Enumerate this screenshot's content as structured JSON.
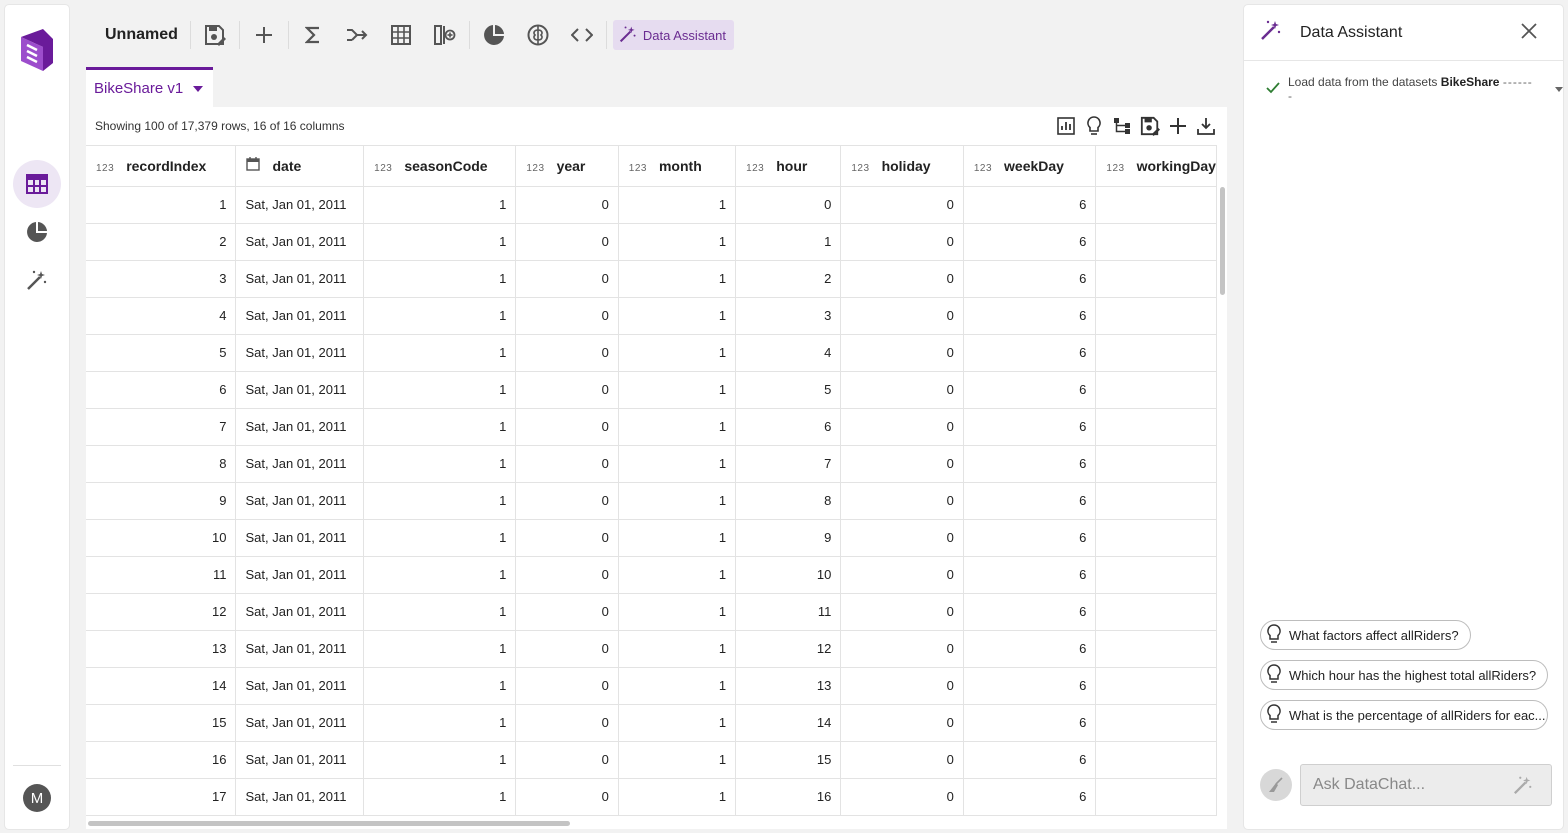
{
  "toolbar": {
    "title": "Unnamed",
    "assistant_label": "Data Assistant"
  },
  "tab": {
    "label": "BikeShare v1"
  },
  "grid": {
    "info": "Showing 100 of 17,379 rows, 16 of 16 columns",
    "type_num": "123",
    "columns": [
      {
        "name": "recordIndex",
        "type": "123"
      },
      {
        "name": "date",
        "type": "calendar"
      },
      {
        "name": "seasonCode",
        "type": "123"
      },
      {
        "name": "year",
        "type": "123"
      },
      {
        "name": "month",
        "type": "123"
      },
      {
        "name": "hour",
        "type": "123"
      },
      {
        "name": "holiday",
        "type": "123"
      },
      {
        "name": "weekDay",
        "type": "123"
      },
      {
        "name": "workingDay",
        "type": "123"
      }
    ],
    "rows": [
      [
        "1",
        "Sat, Jan 01, 2011",
        "1",
        "0",
        "1",
        "0",
        "0",
        "6",
        ""
      ],
      [
        "2",
        "Sat, Jan 01, 2011",
        "1",
        "0",
        "1",
        "1",
        "0",
        "6",
        ""
      ],
      [
        "3",
        "Sat, Jan 01, 2011",
        "1",
        "0",
        "1",
        "2",
        "0",
        "6",
        ""
      ],
      [
        "4",
        "Sat, Jan 01, 2011",
        "1",
        "0",
        "1",
        "3",
        "0",
        "6",
        ""
      ],
      [
        "5",
        "Sat, Jan 01, 2011",
        "1",
        "0",
        "1",
        "4",
        "0",
        "6",
        ""
      ],
      [
        "6",
        "Sat, Jan 01, 2011",
        "1",
        "0",
        "1",
        "5",
        "0",
        "6",
        ""
      ],
      [
        "7",
        "Sat, Jan 01, 2011",
        "1",
        "0",
        "1",
        "6",
        "0",
        "6",
        ""
      ],
      [
        "8",
        "Sat, Jan 01, 2011",
        "1",
        "0",
        "1",
        "7",
        "0",
        "6",
        ""
      ],
      [
        "9",
        "Sat, Jan 01, 2011",
        "1",
        "0",
        "1",
        "8",
        "0",
        "6",
        ""
      ],
      [
        "10",
        "Sat, Jan 01, 2011",
        "1",
        "0",
        "1",
        "9",
        "0",
        "6",
        ""
      ],
      [
        "11",
        "Sat, Jan 01, 2011",
        "1",
        "0",
        "1",
        "10",
        "0",
        "6",
        ""
      ],
      [
        "12",
        "Sat, Jan 01, 2011",
        "1",
        "0",
        "1",
        "11",
        "0",
        "6",
        ""
      ],
      [
        "13",
        "Sat, Jan 01, 2011",
        "1",
        "0",
        "1",
        "12",
        "0",
        "6",
        ""
      ],
      [
        "14",
        "Sat, Jan 01, 2011",
        "1",
        "0",
        "1",
        "13",
        "0",
        "6",
        ""
      ],
      [
        "15",
        "Sat, Jan 01, 2011",
        "1",
        "0",
        "1",
        "14",
        "0",
        "6",
        ""
      ],
      [
        "16",
        "Sat, Jan 01, 2011",
        "1",
        "0",
        "1",
        "15",
        "0",
        "6",
        ""
      ],
      [
        "17",
        "Sat, Jan 01, 2011",
        "1",
        "0",
        "1",
        "16",
        "0",
        "6",
        ""
      ]
    ]
  },
  "assistant": {
    "title": "Data Assistant",
    "step_prefix": "Load data from the datasets",
    "step_dataset": "BikeShare",
    "step_dashes": "-------",
    "suggestions": [
      "What factors affect allRiders?",
      "Which hour has the highest total allRiders?",
      "What is the percentage of allRiders for eac..."
    ],
    "ask_placeholder": "Ask DataChat..."
  },
  "user": {
    "initial": "M"
  },
  "colors": {
    "accent": "#6a1b9a",
    "accent_light": "#e6dcf0",
    "check": "#2e7d32"
  }
}
